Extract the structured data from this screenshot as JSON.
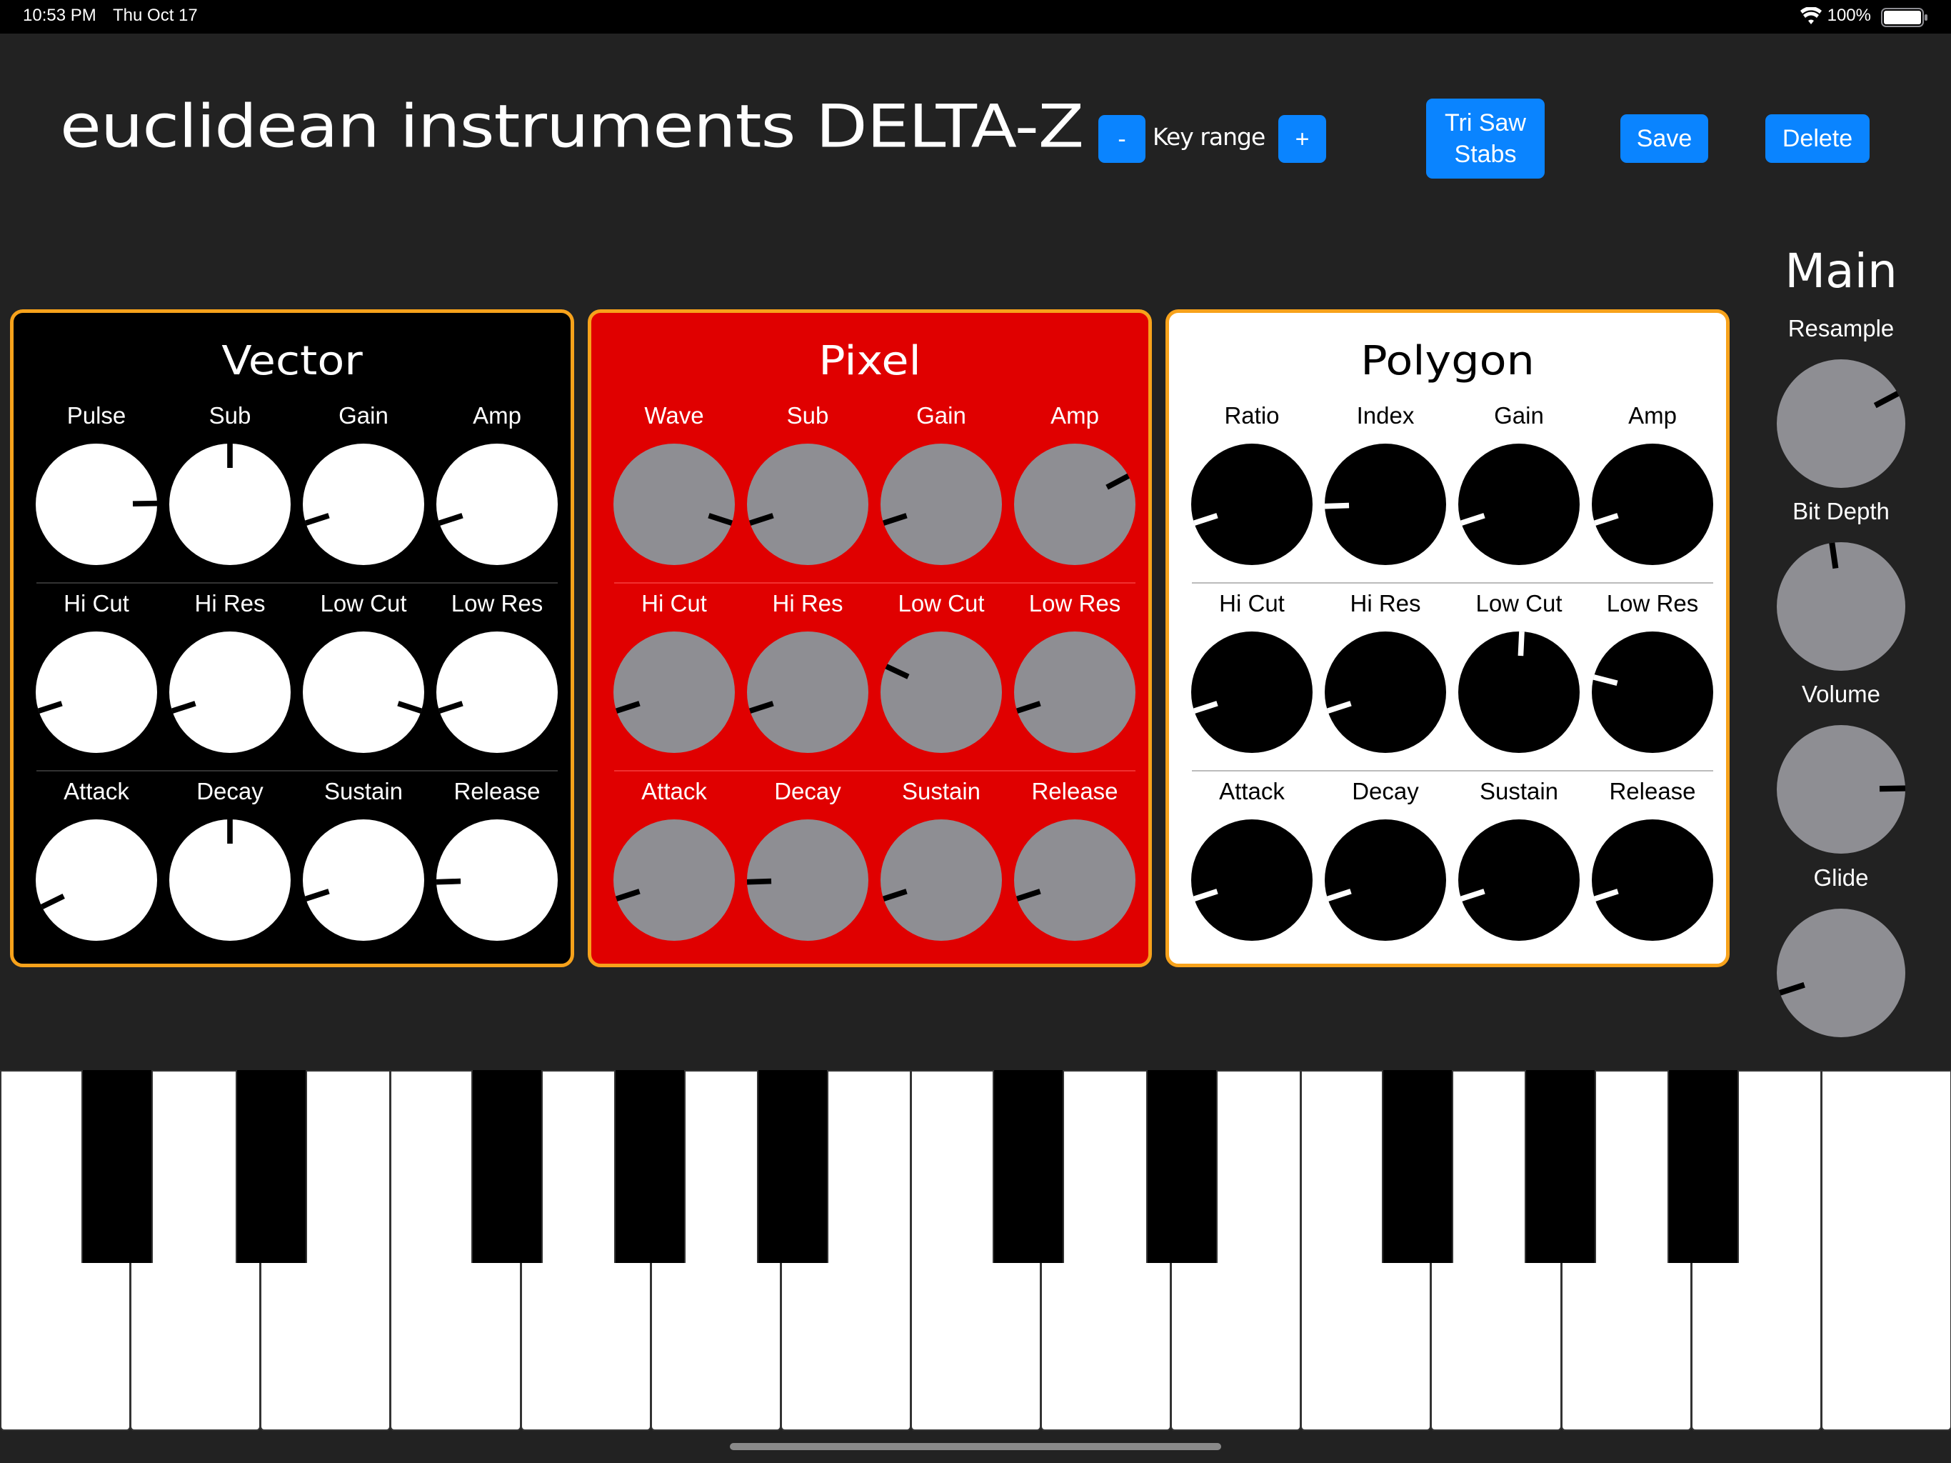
{
  "status_bar": {
    "time": "10:53 PM",
    "date": "Thu Oct 17",
    "battery": "100%"
  },
  "header": {
    "title": "euclidean instruments DELTA-Z",
    "key_minus": "-",
    "key_range_label": "Key range",
    "key_plus": "+",
    "preset_line1": "Tri Saw",
    "preset_line2": "Stabs",
    "save": "Save",
    "delete": "Delete"
  },
  "colors": {
    "accent": "#0a84ff",
    "panel_border": "#f7a21b",
    "vector_bg": "#000000",
    "pixel_bg": "#e00000",
    "polygon_bg": "#ffffff",
    "vector_knob": "#ffffff",
    "pixel_knob": "#8e8e93",
    "polygon_knob": "#000000",
    "main_knob": "#8e8e93"
  },
  "panels": [
    {
      "title": "Vector",
      "knobs": [
        {
          "label": "Pulse",
          "value": 0.83
        },
        {
          "label": "Sub",
          "value": 0.5
        },
        {
          "label": "Gain",
          "value": 0.1
        },
        {
          "label": "Amp",
          "value": 0.1
        },
        {
          "label": "Hi Cut",
          "value": 0.1
        },
        {
          "label": "Hi Res",
          "value": 0.1
        },
        {
          "label": "Low Cut",
          "value": 0.9
        },
        {
          "label": "Low Res",
          "value": 0.1
        },
        {
          "label": "Attack",
          "value": 0.07
        },
        {
          "label": "Decay",
          "value": 0.5
        },
        {
          "label": "Sustain",
          "value": 0.1
        },
        {
          "label": "Release",
          "value": 0.16
        }
      ]
    },
    {
      "title": "Pixel",
      "knobs": [
        {
          "label": "Wave",
          "value": 0.9
        },
        {
          "label": "Sub",
          "value": 0.1
        },
        {
          "label": "Gain",
          "value": 0.1
        },
        {
          "label": "Amp",
          "value": 0.73
        },
        {
          "label": "Hi Cut",
          "value": 0.1
        },
        {
          "label": "Hi Res",
          "value": 0.1
        },
        {
          "label": "Low Cut",
          "value": 0.26
        },
        {
          "label": "Low Res",
          "value": 0.1
        },
        {
          "label": "Attack",
          "value": 0.1
        },
        {
          "label": "Decay",
          "value": 0.16
        },
        {
          "label": "Sustain",
          "value": 0.1
        },
        {
          "label": "Release",
          "value": 0.1
        }
      ]
    },
    {
      "title": "Polygon",
      "knobs": [
        {
          "label": "Ratio",
          "value": 0.1
        },
        {
          "label": "Index",
          "value": 0.16
        },
        {
          "label": "Gain",
          "value": 0.1
        },
        {
          "label": "Amp",
          "value": 0.1
        },
        {
          "label": "Hi Cut",
          "value": 0.1
        },
        {
          "label": "Hi Res",
          "value": 0.1
        },
        {
          "label": "Low Cut",
          "value": 0.51
        },
        {
          "label": "Low Res",
          "value": 0.22
        },
        {
          "label": "Attack",
          "value": 0.1
        },
        {
          "label": "Decay",
          "value": 0.1
        },
        {
          "label": "Sustain",
          "value": 0.1
        },
        {
          "label": "Release",
          "value": 0.1
        }
      ]
    }
  ],
  "main": {
    "title": "Main",
    "knobs": [
      {
        "label": "Resample",
        "value": 0.73
      },
      {
        "label": "Bit Depth",
        "value": 0.47
      },
      {
        "label": "Volume",
        "value": 0.83
      },
      {
        "label": "Glide",
        "value": 0.1
      }
    ]
  }
}
